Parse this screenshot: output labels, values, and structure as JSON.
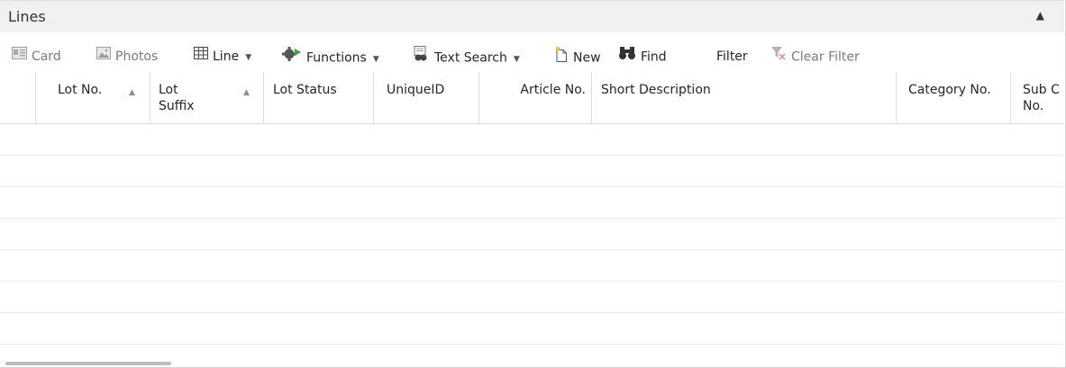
{
  "panel": {
    "title": "Lines",
    "collapse_icon": "chevron-up-icon"
  },
  "toolbar": {
    "card": "Card",
    "photos": "Photos",
    "line": "Line",
    "functions": "Functions",
    "text_search": "Text Search",
    "new": "New",
    "find": "Find",
    "filter": "Filter",
    "clear_filter": "Clear Filter"
  },
  "columns": {
    "lot_no": "Lot No.",
    "lot_suffix_1": "Lot",
    "lot_suffix_2": "Suffix",
    "lot_status": "Lot Status",
    "unique_id": "UniqueID",
    "article_no": "Article No.",
    "short_description": "Short Description",
    "category_no": "Category No.",
    "sub_cat_1": "Sub C",
    "sub_cat_2": "No."
  },
  "colors": {
    "header_bg": "#f1f1f1",
    "border": "#dcdcdc",
    "text": "#262626",
    "disabled": "#7b7b7b"
  }
}
